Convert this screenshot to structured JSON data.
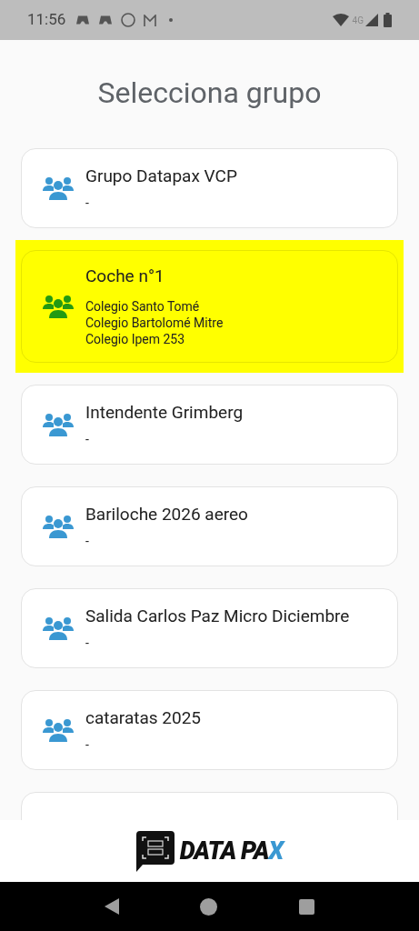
{
  "status_bar": {
    "time": "11:56",
    "network": "4G"
  },
  "title": "Selecciona grupo",
  "groups": [
    {
      "title": "Grupo Datapax VCP",
      "lines": [
        "-"
      ],
      "selected": false
    },
    {
      "title": "Coche n°1",
      "lines": [
        "Colegio Santo Tomé",
        "Colegio Bartolomé Mitre",
        "Colegio Ipem 253"
      ],
      "selected": true
    },
    {
      "title": "Intendente Grimberg",
      "lines": [
        "-"
      ],
      "selected": false
    },
    {
      "title": "Bariloche 2026 aereo",
      "lines": [
        "-"
      ],
      "selected": false
    },
    {
      "title": "Salida Carlos Paz Micro Diciembre",
      "lines": [
        "-"
      ],
      "selected": false
    },
    {
      "title": "cataratas 2025",
      "lines": [
        "-"
      ],
      "selected": false
    },
    {
      "selected": false
    }
  ],
  "footer": {
    "logo_text": "DATA PAX"
  }
}
